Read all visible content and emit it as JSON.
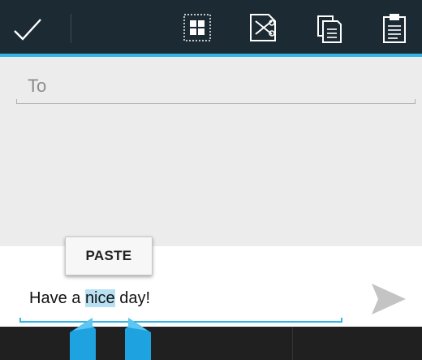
{
  "action_bar": {
    "done_icon": "checkmark-icon",
    "actions": [
      "select-all-icon",
      "cut-icon",
      "copy-icon",
      "paste-icon"
    ],
    "background": "#1c2a33",
    "accent": "#33b5e5"
  },
  "to_field": {
    "placeholder": "To"
  },
  "paste_popup": {
    "label": "PASTE"
  },
  "message": {
    "before": "Have a ",
    "selected": "nice",
    "after": " day!",
    "selection_color": "#b7e1f3"
  },
  "send": {
    "icon": "send-icon"
  }
}
